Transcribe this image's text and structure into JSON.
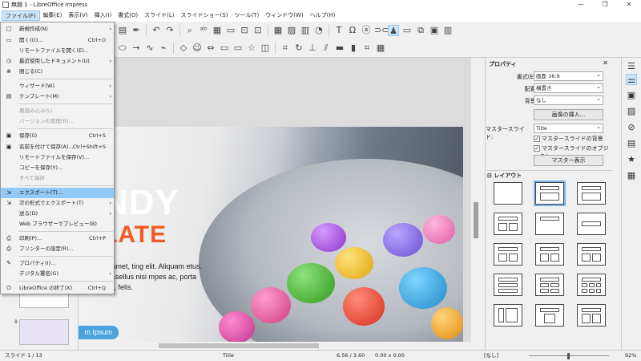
{
  "window": {
    "title": "無題 1 - LibreOffice Impress",
    "min": "—",
    "max": "❐",
    "close": "✕"
  },
  "menubar": [
    "ファイル(F)",
    "編集(E)",
    "表示(V)",
    "挿入(I)",
    "書式(O)",
    "スライド(L)",
    "スライドショー(S)",
    "ツール(T)",
    "ウィンドウ(W)",
    "ヘルプ(H)"
  ],
  "file_menu": [
    {
      "icon": "□",
      "label": "新規作成(N)",
      "shortcut": "",
      "arrow": "›",
      "disabled": false
    },
    {
      "icon": "▭",
      "label": "開く(O)...",
      "shortcut": "Ctrl+O",
      "arrow": "",
      "disabled": false
    },
    {
      "icon": "",
      "label": "リモートファイルを開く(E)...",
      "shortcut": "",
      "arrow": "",
      "disabled": false
    },
    {
      "icon": "◷",
      "label": "最近使用したドキュメント(U)",
      "shortcut": "",
      "arrow": "›",
      "disabled": false
    },
    {
      "icon": "⊗",
      "label": "閉じる(C)",
      "shortcut": "",
      "arrow": "",
      "disabled": false
    },
    {
      "icon": "",
      "label": "ウィザード(W)",
      "shortcut": "",
      "arrow": "›",
      "disabled": false
    },
    {
      "icon": "▤",
      "label": "テンプレート(M)",
      "shortcut": "",
      "arrow": "›",
      "disabled": false
    },
    {
      "icon": "",
      "label": "再読み込み(L)",
      "shortcut": "",
      "arrow": "",
      "disabled": true
    },
    {
      "icon": "",
      "label": "バージョンの管理(R)...",
      "shortcut": "",
      "arrow": "",
      "disabled": true
    },
    {
      "icon": "▣",
      "label": "保存(S)",
      "shortcut": "Ctrl+S",
      "arrow": "",
      "disabled": false
    },
    {
      "icon": "▣",
      "label": "名前を付けて保存(A)...",
      "shortcut": "Ctrl+Shift+S",
      "arrow": "",
      "disabled": false
    },
    {
      "icon": "",
      "label": "リモートファイルを保存(V)...",
      "shortcut": "",
      "arrow": "",
      "disabled": false
    },
    {
      "icon": "",
      "label": "コピーを保存(Y)...",
      "shortcut": "",
      "arrow": "",
      "disabled": false
    },
    {
      "icon": "",
      "label": "すべて保存",
      "shortcut": "",
      "arrow": "",
      "disabled": true
    },
    {
      "icon": "⇲",
      "label": "エクスポート(T)...",
      "shortcut": "",
      "arrow": "",
      "disabled": false,
      "highlight": true
    },
    {
      "icon": "⇲",
      "label": "次の形式でエクスポート(T)",
      "shortcut": "",
      "arrow": "›",
      "disabled": false
    },
    {
      "icon": "",
      "label": "送る(D)",
      "shortcut": "",
      "arrow": "›",
      "disabled": false
    },
    {
      "icon": "",
      "label": "Web ブラウザーでプレビュー(B)",
      "shortcut": "",
      "arrow": "",
      "disabled": false
    },
    {
      "icon": "⎙",
      "label": "印刷(P)...",
      "shortcut": "Ctrl+P",
      "arrow": "",
      "disabled": false
    },
    {
      "icon": "⎙",
      "label": "プリンターの設定(R)...",
      "shortcut": "",
      "arrow": "",
      "disabled": false
    },
    {
      "icon": "✎",
      "label": "プロパティ(I)...",
      "shortcut": "",
      "arrow": "",
      "disabled": false
    },
    {
      "icon": "",
      "label": "デジタル署名(G)",
      "shortcut": "",
      "arrow": "›",
      "disabled": false
    },
    {
      "icon": "⏻",
      "label": "LibreOffice の終了(X)",
      "shortcut": "Ctrl+Q",
      "arrow": "",
      "disabled": false
    }
  ],
  "slide": {
    "heading1": "NDY",
    "heading2": "LATE",
    "body": "sit amet, ting elit. Aliquam etus. Phasellus nisi mpes ac, porta nec, felis.",
    "button": "m Ipsum"
  },
  "thumbs": [
    "",
    "8"
  ],
  "sidebar": {
    "title": "プロパティ",
    "close": "✕",
    "format_label": "書式(E):",
    "format_value": "画面 16:9",
    "orientation_label": "配置:",
    "orientation_value": "横置き",
    "background_label": "背景:",
    "background_value": "なし",
    "insert_image": "画像の挿入...",
    "master_label": "マスタースライド:",
    "master_value": "Title",
    "master_bg": "マスタースライドの背景",
    "master_obj": "マスタースライドのオブジェクト",
    "master_view": "マスター表示",
    "layout_title": "レイアウト"
  },
  "status": {
    "slide": "スライド 1 / 13",
    "layout": "Title",
    "pos": "6.56 / 3.60",
    "size": "0.00 x 0.00",
    "lang": "[なし]",
    "zoom": "92%"
  },
  "accent": "#91c9f7"
}
